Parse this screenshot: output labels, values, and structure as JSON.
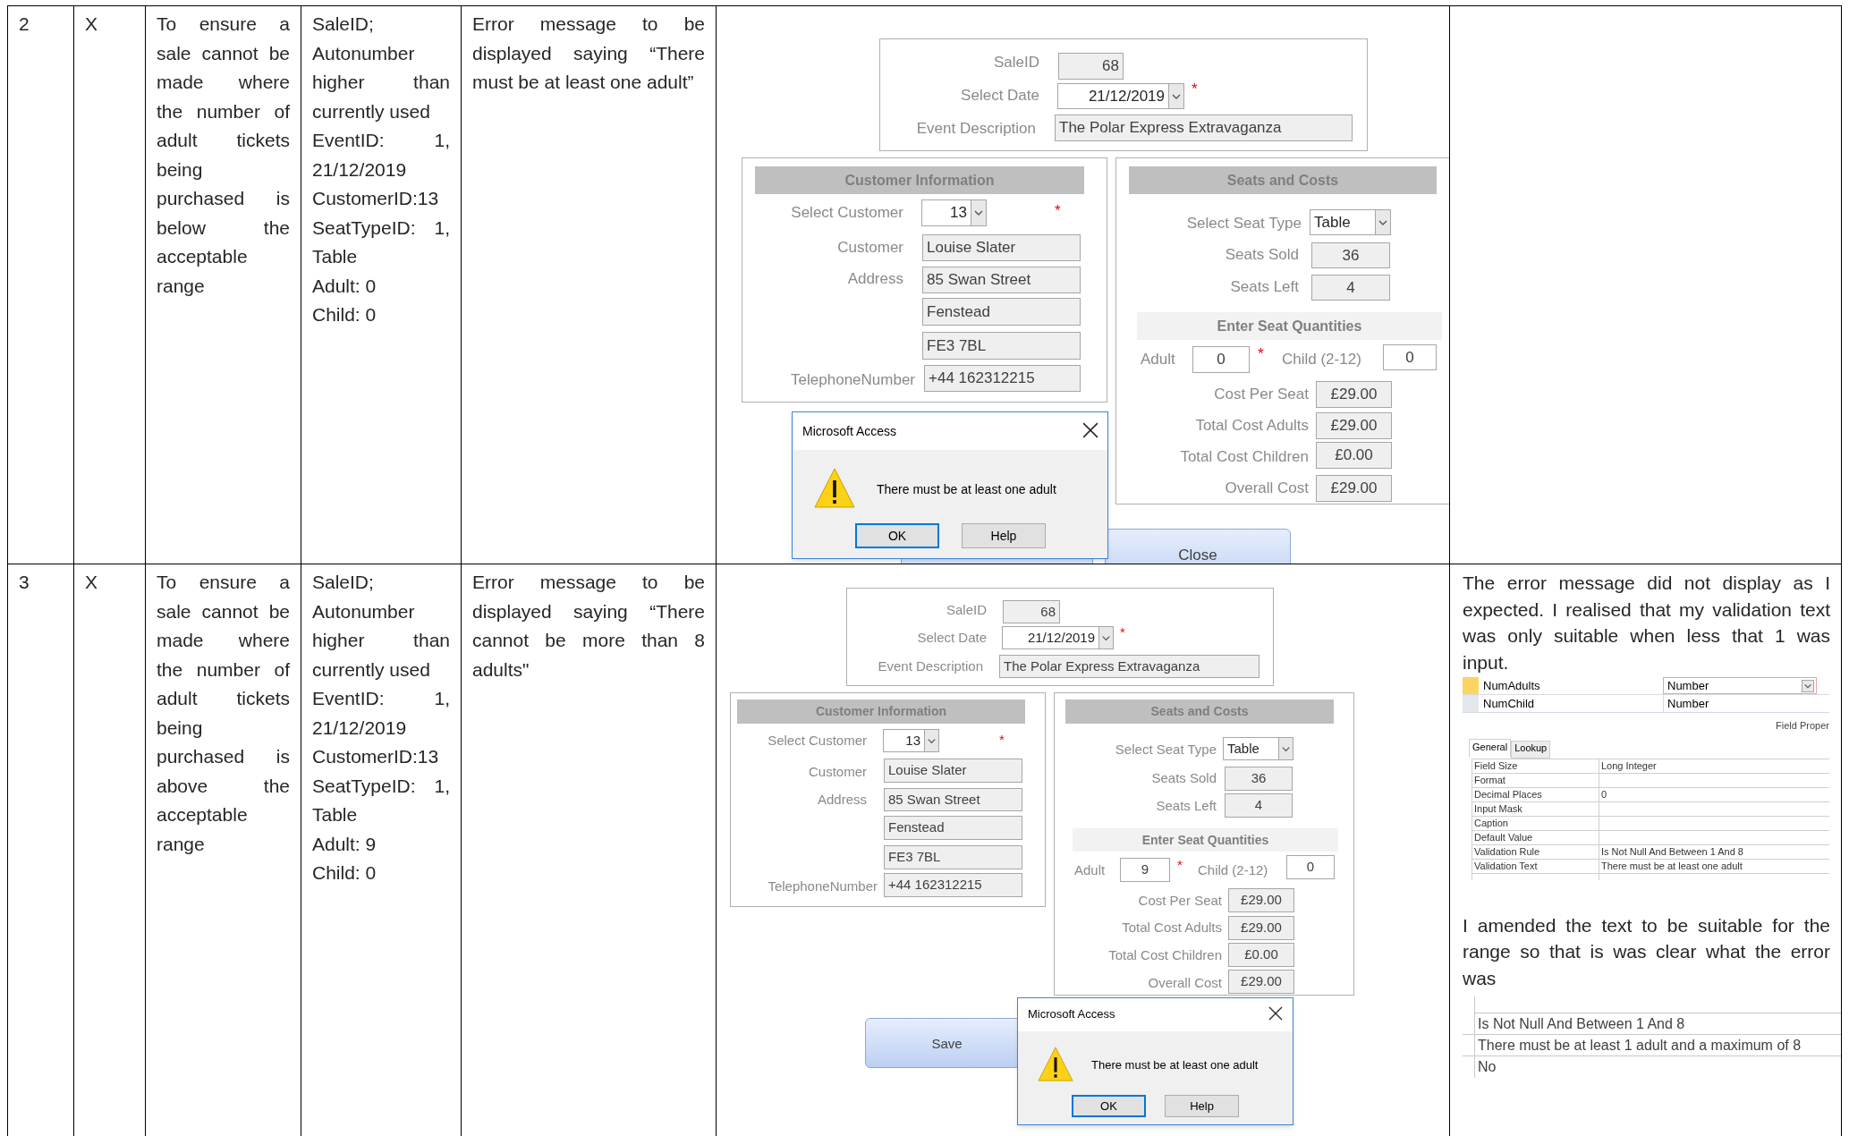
{
  "rows": [
    {
      "number": "2",
      "result": "X",
      "purpose": "To ensure a sale cannot be made where the number of adult tickets being purchased is below the acceptable range",
      "test_data": [
        "SaleID; Autonumber higher than currently used",
        "EventID: 1, 21/12/2019",
        "CustomerID:13",
        "SeatTypeID: 1, Table",
        "Adult: 0",
        "Child: 0"
      ],
      "expected": "Error message to be displayed saying “There must be at least one adult”",
      "screenshot": {
        "sale_id": {
          "label": "SaleID",
          "value": "68"
        },
        "date": {
          "label": "Select Date",
          "value": "21/12/2019",
          "required_mark": "*"
        },
        "event": {
          "label": "Event Description",
          "value": "The Polar Express Extravaganza"
        },
        "customer_section": {
          "heading": "Customer Information",
          "select_label": "Select Customer",
          "customer_id": "13",
          "required_mark": "*",
          "customer_label": "Customer",
          "customer": "Louise Slater",
          "address_label": "Address",
          "address_lines": [
            "85 Swan Street",
            "Fenstead",
            "FE3 7BL"
          ],
          "phone_label": "TelephoneNumber",
          "phone": "+44 162312215"
        },
        "seats_section": {
          "heading": "Seats and Costs",
          "seat_type_label": "Select Seat Type",
          "seat_type": "Table",
          "seats_sold_label": "Seats Sold",
          "seats_sold": "36",
          "seats_left_label": "Seats Left",
          "seats_left": "4",
          "quantities_heading": "Enter Seat Quantities",
          "adult_label": "Adult",
          "adult": "0",
          "adult_required_mark": "*",
          "child_label": "Child (2-12)",
          "child": "0",
          "costs": [
            {
              "label": "Cost Per Seat",
              "value": "£29.00"
            },
            {
              "label": "Total Cost Adults",
              "value": "£29.00"
            },
            {
              "label": "Total Cost Children",
              "value": "£0.00"
            },
            {
              "label": "Overall Cost",
              "value": "£29.00"
            }
          ]
        },
        "buttons": [
          {
            "label": "Close"
          }
        ],
        "dialog": {
          "title": "Microsoft Access",
          "message": "There must be at least one adult",
          "buttons": [
            {
              "label": "OK",
              "focused": true
            },
            {
              "label": "Help",
              "focused": false
            }
          ]
        }
      }
    },
    {
      "number": "3",
      "result": "X",
      "purpose": "To ensure a sale cannot be made where the number of adult tickets being purchased is above the acceptable range",
      "test_data": [
        "SaleID; Autonumber higher than currently used",
        "EventID: 1, 21/12/2019",
        "CustomerID:13",
        "SeatTypeID: 1, Table",
        "Adult: 9",
        "Child: 0"
      ],
      "expected": "Error message to be displayed saying “There cannot be more than 8 adults\"",
      "screenshot": {
        "sale_id": {
          "label": "SaleID",
          "value": "68"
        },
        "date": {
          "label": "Select Date",
          "value": "21/12/2019",
          "required_mark": "*"
        },
        "event": {
          "label": "Event Description",
          "value": "The Polar Express Extravaganza"
        },
        "customer_section": {
          "heading": "Customer Information",
          "select_label": "Select Customer",
          "customer_id": "13",
          "required_mark": "*",
          "customer_label": "Customer",
          "customer": "Louise Slater",
          "address_label": "Address",
          "address_lines": [
            "85 Swan Street",
            "Fenstead",
            "FE3 7BL"
          ],
          "phone_label": "TelephoneNumber",
          "phone": "+44 162312215"
        },
        "seats_section": {
          "heading": "Seats and Costs",
          "seat_type_label": "Select Seat Type",
          "seat_type": "Table",
          "seats_sold_label": "Seats Sold",
          "seats_sold": "36",
          "seats_left_label": "Seats Left",
          "seats_left": "4",
          "quantities_heading": "Enter Seat Quantities",
          "adult_label": "Adult",
          "adult": "9",
          "adult_required_mark": "*",
          "child_label": "Child (2-12)",
          "child": "0",
          "costs": [
            {
              "label": "Cost Per Seat",
              "value": "£29.00"
            },
            {
              "label": "Total Cost Adults",
              "value": "£29.00"
            },
            {
              "label": "Total Cost Children",
              "value": "£0.00"
            },
            {
              "label": "Overall Cost",
              "value": "£29.00"
            }
          ]
        },
        "buttons": [
          {
            "label": "Save"
          }
        ],
        "dialog": {
          "title": "Microsoft Access",
          "message": "There must be at least one adult",
          "buttons": [
            {
              "label": "OK",
              "focused": true
            },
            {
              "label": "Help",
              "focused": false
            }
          ]
        }
      },
      "comments": {
        "paragraphs": [
          "The error message did not display as I expected. I realised that my validation text was only suitable when less that 1 was input.",
          "I amended the text to be suitable for the range so that is was clear what the error was"
        ],
        "fields": [
          {
            "name": "NumAdults",
            "type": "Number",
            "selected": true
          },
          {
            "name": "NumChild",
            "type": "Number",
            "selected": false
          }
        ],
        "properties_caption": "Field Proper",
        "property_tabs": [
          {
            "label": "General",
            "selected": true
          },
          {
            "label": "Lookup",
            "selected": false
          }
        ],
        "properties": [
          {
            "name": "Field Size",
            "value": "Long Integer"
          },
          {
            "name": "Format"
          },
          {
            "name": "Decimal Places",
            "value": "0"
          },
          {
            "name": "Input Mask"
          },
          {
            "name": "Caption"
          },
          {
            "name": "Default Value"
          },
          {
            "name": "Validation Rule",
            "value": "Is Not Null And Between 1 And 8"
          },
          {
            "name": "Validation Text",
            "value": "There must be at least one adult"
          }
        ],
        "amended_values": [
          "Is Not Null And Between 1 And 8",
          "There must be at least 1 adult and a maximum of 8",
          "No"
        ]
      }
    }
  ]
}
